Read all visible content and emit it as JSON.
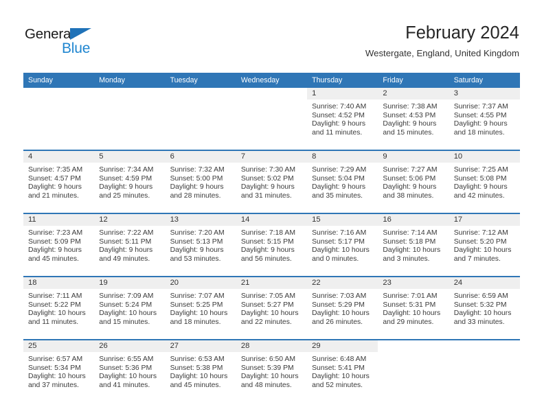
{
  "brand": {
    "name_part1": "General",
    "name_part2": "Blue",
    "triangle_color": "#1f72b8",
    "blue_color": "#1f86d0"
  },
  "header": {
    "title": "February 2024",
    "location": "Westergate, England, United Kingdom"
  },
  "theme": {
    "header_blue": "#2f76b6",
    "daynum_gray": "#efefef",
    "text": "#333333"
  },
  "weekdays": [
    "Sunday",
    "Monday",
    "Tuesday",
    "Wednesday",
    "Thursday",
    "Friday",
    "Saturday"
  ],
  "weeks": [
    [
      {
        "day": "",
        "sunrise": "",
        "sunset": "",
        "daylight1": "",
        "daylight2": "",
        "blank": true
      },
      {
        "day": "",
        "sunrise": "",
        "sunset": "",
        "daylight1": "",
        "daylight2": "",
        "blank": true
      },
      {
        "day": "",
        "sunrise": "",
        "sunset": "",
        "daylight1": "",
        "daylight2": "",
        "blank": true
      },
      {
        "day": "",
        "sunrise": "",
        "sunset": "",
        "daylight1": "",
        "daylight2": "",
        "blank": true
      },
      {
        "day": "1",
        "sunrise": "Sunrise: 7:40 AM",
        "sunset": "Sunset: 4:52 PM",
        "daylight1": "Daylight: 9 hours",
        "daylight2": "and 11 minutes."
      },
      {
        "day": "2",
        "sunrise": "Sunrise: 7:38 AM",
        "sunset": "Sunset: 4:53 PM",
        "daylight1": "Daylight: 9 hours",
        "daylight2": "and 15 minutes."
      },
      {
        "day": "3",
        "sunrise": "Sunrise: 7:37 AM",
        "sunset": "Sunset: 4:55 PM",
        "daylight1": "Daylight: 9 hours",
        "daylight2": "and 18 minutes."
      }
    ],
    [
      {
        "day": "4",
        "sunrise": "Sunrise: 7:35 AM",
        "sunset": "Sunset: 4:57 PM",
        "daylight1": "Daylight: 9 hours",
        "daylight2": "and 21 minutes."
      },
      {
        "day": "5",
        "sunrise": "Sunrise: 7:34 AM",
        "sunset": "Sunset: 4:59 PM",
        "daylight1": "Daylight: 9 hours",
        "daylight2": "and 25 minutes."
      },
      {
        "day": "6",
        "sunrise": "Sunrise: 7:32 AM",
        "sunset": "Sunset: 5:00 PM",
        "daylight1": "Daylight: 9 hours",
        "daylight2": "and 28 minutes."
      },
      {
        "day": "7",
        "sunrise": "Sunrise: 7:30 AM",
        "sunset": "Sunset: 5:02 PM",
        "daylight1": "Daylight: 9 hours",
        "daylight2": "and 31 minutes."
      },
      {
        "day": "8",
        "sunrise": "Sunrise: 7:29 AM",
        "sunset": "Sunset: 5:04 PM",
        "daylight1": "Daylight: 9 hours",
        "daylight2": "and 35 minutes."
      },
      {
        "day": "9",
        "sunrise": "Sunrise: 7:27 AM",
        "sunset": "Sunset: 5:06 PM",
        "daylight1": "Daylight: 9 hours",
        "daylight2": "and 38 minutes."
      },
      {
        "day": "10",
        "sunrise": "Sunrise: 7:25 AM",
        "sunset": "Sunset: 5:08 PM",
        "daylight1": "Daylight: 9 hours",
        "daylight2": "and 42 minutes."
      }
    ],
    [
      {
        "day": "11",
        "sunrise": "Sunrise: 7:23 AM",
        "sunset": "Sunset: 5:09 PM",
        "daylight1": "Daylight: 9 hours",
        "daylight2": "and 45 minutes."
      },
      {
        "day": "12",
        "sunrise": "Sunrise: 7:22 AM",
        "sunset": "Sunset: 5:11 PM",
        "daylight1": "Daylight: 9 hours",
        "daylight2": "and 49 minutes."
      },
      {
        "day": "13",
        "sunrise": "Sunrise: 7:20 AM",
        "sunset": "Sunset: 5:13 PM",
        "daylight1": "Daylight: 9 hours",
        "daylight2": "and 53 minutes."
      },
      {
        "day": "14",
        "sunrise": "Sunrise: 7:18 AM",
        "sunset": "Sunset: 5:15 PM",
        "daylight1": "Daylight: 9 hours",
        "daylight2": "and 56 minutes."
      },
      {
        "day": "15",
        "sunrise": "Sunrise: 7:16 AM",
        "sunset": "Sunset: 5:17 PM",
        "daylight1": "Daylight: 10 hours",
        "daylight2": "and 0 minutes."
      },
      {
        "day": "16",
        "sunrise": "Sunrise: 7:14 AM",
        "sunset": "Sunset: 5:18 PM",
        "daylight1": "Daylight: 10 hours",
        "daylight2": "and 3 minutes."
      },
      {
        "day": "17",
        "sunrise": "Sunrise: 7:12 AM",
        "sunset": "Sunset: 5:20 PM",
        "daylight1": "Daylight: 10 hours",
        "daylight2": "and 7 minutes."
      }
    ],
    [
      {
        "day": "18",
        "sunrise": "Sunrise: 7:11 AM",
        "sunset": "Sunset: 5:22 PM",
        "daylight1": "Daylight: 10 hours",
        "daylight2": "and 11 minutes."
      },
      {
        "day": "19",
        "sunrise": "Sunrise: 7:09 AM",
        "sunset": "Sunset: 5:24 PM",
        "daylight1": "Daylight: 10 hours",
        "daylight2": "and 15 minutes."
      },
      {
        "day": "20",
        "sunrise": "Sunrise: 7:07 AM",
        "sunset": "Sunset: 5:25 PM",
        "daylight1": "Daylight: 10 hours",
        "daylight2": "and 18 minutes."
      },
      {
        "day": "21",
        "sunrise": "Sunrise: 7:05 AM",
        "sunset": "Sunset: 5:27 PM",
        "daylight1": "Daylight: 10 hours",
        "daylight2": "and 22 minutes."
      },
      {
        "day": "22",
        "sunrise": "Sunrise: 7:03 AM",
        "sunset": "Sunset: 5:29 PM",
        "daylight1": "Daylight: 10 hours",
        "daylight2": "and 26 minutes."
      },
      {
        "day": "23",
        "sunrise": "Sunrise: 7:01 AM",
        "sunset": "Sunset: 5:31 PM",
        "daylight1": "Daylight: 10 hours",
        "daylight2": "and 29 minutes."
      },
      {
        "day": "24",
        "sunrise": "Sunrise: 6:59 AM",
        "sunset": "Sunset: 5:32 PM",
        "daylight1": "Daylight: 10 hours",
        "daylight2": "and 33 minutes."
      }
    ],
    [
      {
        "day": "25",
        "sunrise": "Sunrise: 6:57 AM",
        "sunset": "Sunset: 5:34 PM",
        "daylight1": "Daylight: 10 hours",
        "daylight2": "and 37 minutes."
      },
      {
        "day": "26",
        "sunrise": "Sunrise: 6:55 AM",
        "sunset": "Sunset: 5:36 PM",
        "daylight1": "Daylight: 10 hours",
        "daylight2": "and 41 minutes."
      },
      {
        "day": "27",
        "sunrise": "Sunrise: 6:53 AM",
        "sunset": "Sunset: 5:38 PM",
        "daylight1": "Daylight: 10 hours",
        "daylight2": "and 45 minutes."
      },
      {
        "day": "28",
        "sunrise": "Sunrise: 6:50 AM",
        "sunset": "Sunset: 5:39 PM",
        "daylight1": "Daylight: 10 hours",
        "daylight2": "and 48 minutes."
      },
      {
        "day": "29",
        "sunrise": "Sunrise: 6:48 AM",
        "sunset": "Sunset: 5:41 PM",
        "daylight1": "Daylight: 10 hours",
        "daylight2": "and 52 minutes."
      },
      {
        "day": "",
        "sunrise": "",
        "sunset": "",
        "daylight1": "",
        "daylight2": "",
        "blank": true
      },
      {
        "day": "",
        "sunrise": "",
        "sunset": "",
        "daylight1": "",
        "daylight2": "",
        "blank": true
      }
    ]
  ]
}
